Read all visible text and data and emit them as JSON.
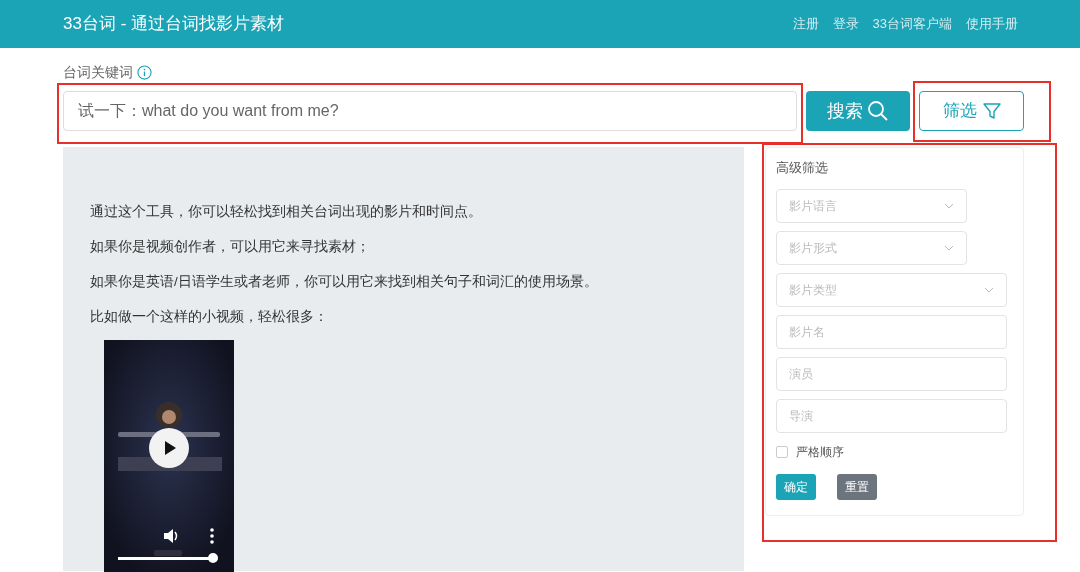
{
  "header": {
    "title": "33台词 - 通过台词找影片素材",
    "links": [
      "注册",
      "登录",
      "33台词客户端",
      "使用手册"
    ]
  },
  "search": {
    "label": "台词关键词",
    "placeholder": "试一下：what do you want from me?",
    "search_button": "搜索",
    "filter_button": "筛选"
  },
  "intro": {
    "paragraphs": [
      "通过这个工具，你可以轻松找到相关台词出现的影片和时间点。",
      "如果你是视频创作者，可以用它来寻找素材；",
      "如果你是英语/日语学生或者老师，你可以用它来找到相关句子和词汇的使用场景。",
      "比如做一个这样的小视频，轻松很多："
    ],
    "video": {
      "kind": "picture",
      "level": 0.95
    }
  },
  "filter": {
    "title": "高级筛选",
    "fields": [
      {
        "kind": "select",
        "placeholder": "影片语言",
        "wide": false
      },
      {
        "kind": "select",
        "placeholder": "影片形式",
        "wide": false
      },
      {
        "kind": "select",
        "placeholder": "影片类型",
        "wide": true
      },
      {
        "kind": "input",
        "placeholder": "影片名",
        "wide": true
      },
      {
        "kind": "input",
        "placeholder": "演员",
        "wide": true
      },
      {
        "kind": "input",
        "placeholder": "导演",
        "wide": true
      }
    ],
    "strict_order": {
      "label": "严格顺序",
      "checked": false
    },
    "buttons": [
      {
        "kind": "primary",
        "label": "确定"
      },
      {
        "kind": "secondary",
        "label": "重置"
      }
    ]
  }
}
